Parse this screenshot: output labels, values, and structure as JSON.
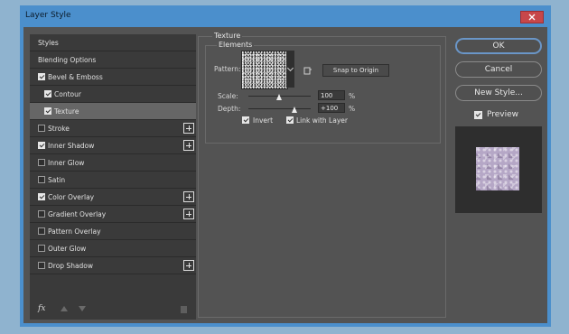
{
  "window": {
    "title": "Layer Style"
  },
  "styles_list": {
    "items": [
      {
        "label": "Styles",
        "checkbox": false,
        "checked": false,
        "plus": false,
        "selected": false,
        "indent": 0
      },
      {
        "label": "Blending Options",
        "checkbox": false,
        "checked": false,
        "plus": false,
        "selected": false,
        "indent": 0
      },
      {
        "label": "Bevel & Emboss",
        "checkbox": true,
        "checked": true,
        "plus": false,
        "selected": false,
        "indent": 0
      },
      {
        "label": "Contour",
        "checkbox": true,
        "checked": true,
        "plus": false,
        "selected": false,
        "indent": 1
      },
      {
        "label": "Texture",
        "checkbox": true,
        "checked": true,
        "plus": false,
        "selected": true,
        "indent": 1
      },
      {
        "label": "Stroke",
        "checkbox": true,
        "checked": false,
        "plus": true,
        "selected": false,
        "indent": 0
      },
      {
        "label": "Inner Shadow",
        "checkbox": true,
        "checked": true,
        "plus": true,
        "selected": false,
        "indent": 0
      },
      {
        "label": "Inner Glow",
        "checkbox": true,
        "checked": false,
        "plus": false,
        "selected": false,
        "indent": 0
      },
      {
        "label": "Satin",
        "checkbox": true,
        "checked": false,
        "plus": false,
        "selected": false,
        "indent": 0
      },
      {
        "label": "Color Overlay",
        "checkbox": true,
        "checked": true,
        "plus": true,
        "selected": false,
        "indent": 0
      },
      {
        "label": "Gradient Overlay",
        "checkbox": true,
        "checked": false,
        "plus": true,
        "selected": false,
        "indent": 0
      },
      {
        "label": "Pattern Overlay",
        "checkbox": true,
        "checked": false,
        "plus": false,
        "selected": false,
        "indent": 0
      },
      {
        "label": "Outer Glow",
        "checkbox": true,
        "checked": false,
        "plus": false,
        "selected": false,
        "indent": 0
      },
      {
        "label": "Drop Shadow",
        "checkbox": true,
        "checked": false,
        "plus": true,
        "selected": false,
        "indent": 0
      }
    ],
    "footer": {
      "fx_label": "fx"
    }
  },
  "texture": {
    "section_title": "Texture",
    "group_title": "Elements",
    "pattern_label": "Pattern:",
    "snap_label": "Snap to Origin",
    "scale_label": "Scale:",
    "scale_value": "100",
    "scale_pct": 0.5,
    "depth_label": "Depth:",
    "depth_value": "+100",
    "depth_pct": 0.75,
    "unit": "%",
    "invert_label": "Invert",
    "invert_checked": true,
    "link_label": "Link with Layer",
    "link_checked": true
  },
  "actions": {
    "ok": "OK",
    "cancel": "Cancel",
    "new_style": "New Style...",
    "preview_label": "Preview",
    "preview_checked": true
  }
}
